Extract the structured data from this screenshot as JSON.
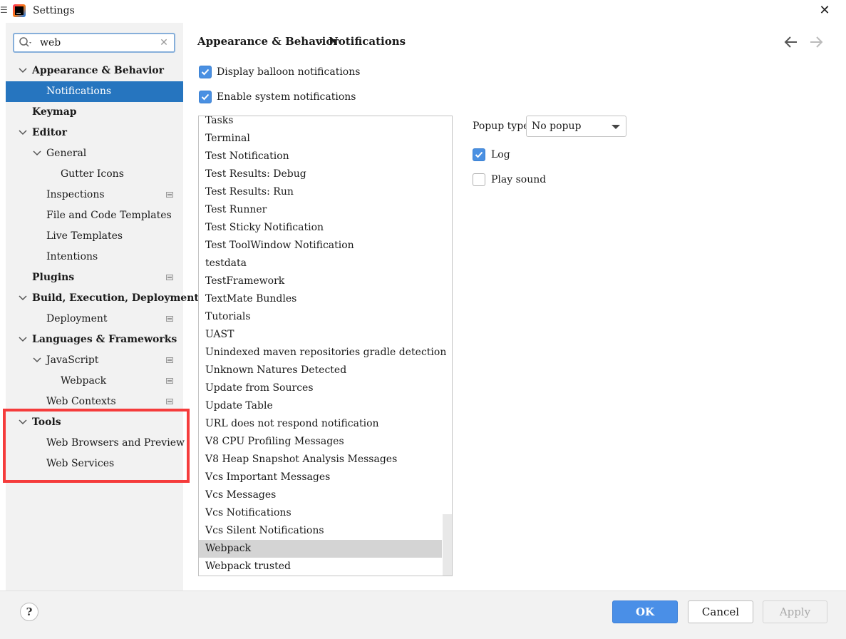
{
  "window": {
    "title": "Settings",
    "app_icon": "intellij-idea-icon",
    "close_icon": "close-icon"
  },
  "search": {
    "value": "web",
    "placeholder": "",
    "icon": "search-icon",
    "clear_icon": "clear-icon"
  },
  "tree": {
    "items": [
      {
        "label": "Appearance & Behavior",
        "expanded": true,
        "bold": true,
        "badge": false
      },
      {
        "label": "Notifications",
        "selected": true,
        "badge": false
      },
      {
        "label": "Keymap",
        "bold": true,
        "badge": false
      },
      {
        "label": "Editor",
        "expanded": true,
        "bold": true,
        "badge": false
      },
      {
        "label": "General",
        "expanded": true,
        "badge": false
      },
      {
        "label": "Gutter Icons",
        "badge": false
      },
      {
        "label": "Inspections",
        "badge": true
      },
      {
        "label": "File and Code Templates",
        "badge": false
      },
      {
        "label": "Live Templates",
        "badge": false
      },
      {
        "label": "Intentions",
        "badge": false
      },
      {
        "label": "Plugins",
        "bold": true,
        "badge": true
      },
      {
        "label": "Build, Execution, Deployment",
        "expanded": true,
        "bold": true,
        "badge": false
      },
      {
        "label": "Deployment",
        "badge": true
      },
      {
        "label": "Languages & Frameworks",
        "expanded": true,
        "bold": true,
        "badge": false
      },
      {
        "label": "JavaScript",
        "expanded": true,
        "badge": true
      },
      {
        "label": "Webpack",
        "badge": true
      },
      {
        "label": "Web Contexts",
        "badge": true
      },
      {
        "label": "Tools",
        "expanded": true,
        "bold": true,
        "badge": false
      },
      {
        "label": "Web Browsers and Preview",
        "badge": false
      },
      {
        "label": "Web Services",
        "badge": false
      }
    ]
  },
  "breadcrumb": {
    "parent": "Appearance & Behavior",
    "separator": "›",
    "current": "Notifications"
  },
  "nav": {
    "back_icon": "arrow-left-icon",
    "forward_icon": "arrow-right-icon"
  },
  "options": {
    "display_balloon": {
      "label": "Display balloon notifications",
      "checked": true
    },
    "enable_system": {
      "label": "Enable system notifications",
      "checked": true
    }
  },
  "notification_groups": [
    "Tasks",
    "Terminal",
    "Test Notification",
    "Test Results: Debug",
    "Test Results: Run",
    "Test Runner",
    "Test Sticky Notification",
    "Test ToolWindow Notification",
    "testdata",
    "TestFramework",
    "TextMate Bundles",
    "Tutorials",
    "UAST",
    "Unindexed maven repositories gradle detection",
    "Unknown Natures Detected",
    "Update from Sources",
    "Update Table",
    "URL does not respond notification",
    "V8 CPU Profiling Messages",
    "V8 Heap Snapshot Analysis Messages",
    "Vcs Important Messages",
    "Vcs Messages",
    "Vcs Notifications",
    "Vcs Silent Notifications",
    "Webpack",
    "Webpack trusted"
  ],
  "selected_group": "Webpack",
  "group_settings": {
    "popup_type_label": "Popup type:",
    "popup_type_value": "No popup",
    "log": {
      "label": "Log",
      "checked": true
    },
    "play_sound": {
      "label": "Play sound",
      "checked": false
    }
  },
  "footer": {
    "help": "?",
    "ok": "OK",
    "cancel": "Cancel",
    "apply": "Apply"
  },
  "colors": {
    "selection": "#2675bf",
    "highlight_box": "#f53c3c",
    "checkbox": "#4a90e2",
    "ok_button": "#4a8fe7"
  }
}
